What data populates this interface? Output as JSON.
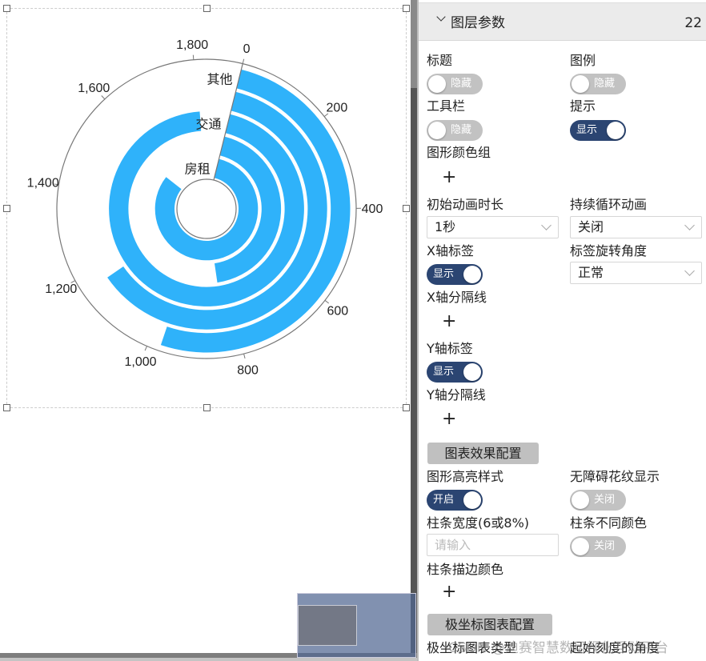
{
  "chart_data": {
    "type": "bar",
    "subtype": "polar-radial-bar",
    "categories": [
      "房租",
      "",
      "交通",
      "",
      "其他"
    ],
    "values": [
      1553,
      832,
      1805,
      1168,
      974
    ],
    "angle_axis": {
      "min": 0,
      "max": 1900,
      "ticks": [
        0,
        200,
        400,
        600,
        800,
        1000,
        1200,
        1400,
        1600,
        1800
      ],
      "tick_labels": [
        "0",
        "200",
        "400",
        "600",
        "800",
        "1,000",
        "1,200",
        "1,400",
        "1,600",
        "1,800"
      ]
    },
    "title": "",
    "xlabel": "",
    "ylabel": "",
    "bar_color": "#2fb2fa"
  },
  "panel": {
    "header": {
      "title": "图层参数",
      "count": "22"
    },
    "title_label": "标题",
    "title_toggle": "隐藏",
    "legend_label": "图例",
    "legend_toggle": "隐藏",
    "toolbar_label": "工具栏",
    "toolbar_toggle": "隐藏",
    "tooltip_label": "提示",
    "tooltip_toggle": "显示",
    "color_group_label": "图形颜色组",
    "anim_label": "初始动画时长",
    "anim_value": "1秒",
    "loop_label": "持续循环动画",
    "loop_value": "关闭",
    "xlabel_label": "X轴标签",
    "xlabel_toggle": "显示",
    "rotate_label": "标签旋转角度",
    "rotate_value": "正常",
    "xsplit_label": "X轴分隔线",
    "ylabel_label": "Y轴标签",
    "ylabel_toggle": "显示",
    "ysplit_label": "Y轴分隔线",
    "effect_section": "图表效果配置",
    "highlight_label": "图形高亮样式",
    "highlight_toggle": "开启",
    "aria_label": "无障碍花纹显示",
    "aria_toggle": "关闭",
    "barwidth_label": "柱条宽度(6或8%)",
    "barwidth_placeholder": "请输入",
    "diffcolor_label": "柱条不同颜色",
    "diffcolor_toggle": "关闭",
    "stroke_label": "柱条描边颜色",
    "polar_section": "极坐标图表配置",
    "polar_type_label": "极坐标图表类型",
    "start_angle_label": "起始刻度的角度",
    "plus": "+"
  },
  "watermark": "CSDN @迪赛智慧数可视化互动平台",
  "colors": {
    "toggle_on": "#2b4572",
    "toggle_off": "#c2c2c2"
  }
}
